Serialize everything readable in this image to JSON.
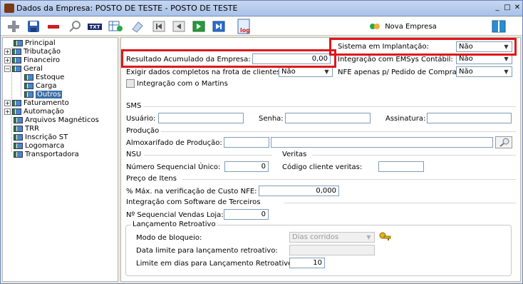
{
  "window": {
    "title": "Dados da Empresa: POSTO DE TESTE - POSTO DE TESTE",
    "minimize": "_",
    "maximize": "□",
    "close": "✕"
  },
  "toolbar": {
    "txt_label": "TXT",
    "log_label": "log",
    "new_company_label": "Nova Empresa"
  },
  "tree": {
    "items": [
      {
        "label": "Principal"
      },
      {
        "label": "Tributação"
      },
      {
        "label": "Financeiro"
      },
      {
        "label": "Geral"
      },
      {
        "label": "Estoque"
      },
      {
        "label": "Carga"
      },
      {
        "label": "Outros"
      },
      {
        "label": "Faturamento"
      },
      {
        "label": "Automação"
      },
      {
        "label": "Arquivos Magnéticos"
      },
      {
        "label": "TRR"
      },
      {
        "label": "Inscrição ST"
      },
      {
        "label": "Logomarca"
      },
      {
        "label": "Transportadora"
      }
    ],
    "expand": "+",
    "collapse": "−"
  },
  "form": {
    "sistema_implantacao": {
      "label": "Sistema em Implantação:",
      "value": "Não"
    },
    "resultado_acumulado": {
      "label": "Resultado Acumulado da Empresa:",
      "value": "0,00"
    },
    "integracao_emsys": {
      "label": "Integração com EMSys Contábil:",
      "value": "Não"
    },
    "exigir_dados": {
      "label": "Exigir dados completos na frota de clientes:",
      "value": "Não"
    },
    "nfe_apenas": {
      "label": "NFE apenas p/ Pedido de Compra:",
      "value": "Não"
    },
    "integracao_martins": {
      "label": "Integração com o Martins"
    },
    "sms": {
      "section": "SMS",
      "usuario_label": "Usuário:",
      "usuario_value": "",
      "senha_label": "Senha:",
      "senha_value": "",
      "assinatura_label": "Assinatura:",
      "assinatura_value": ""
    },
    "producao": {
      "section": "Produção",
      "almox_label": "Almoxarifado de Produção:",
      "almox_code": "",
      "almox_desc": ""
    },
    "nsu": {
      "section": "NSU",
      "numero_label": "Número Sequencial Único:",
      "numero_value": "0"
    },
    "veritas": {
      "section": "Veritas",
      "codigo_label": "Código cliente veritas:",
      "codigo_value": ""
    },
    "preco": {
      "section": "Preço de Itens",
      "max_label": "% Máx. na verificação de Custo NFE:",
      "max_value": "0,000"
    },
    "integracao_terceiros": {
      "section": "Integração com Software de Terceiros",
      "seq_label": "Nº Sequencial Vendas Loja:",
      "seq_value": "0"
    },
    "lancamento": {
      "group": "Lançamento Retroativo",
      "modo_label": "Modo de bloqueio:",
      "modo_value": "Dias corridos",
      "data_label": "Data limite para lançamento retroativo:",
      "data_value": "",
      "limite_label": "Limite em dias para Lançamento Retroativo:",
      "limite_value": "10"
    }
  }
}
